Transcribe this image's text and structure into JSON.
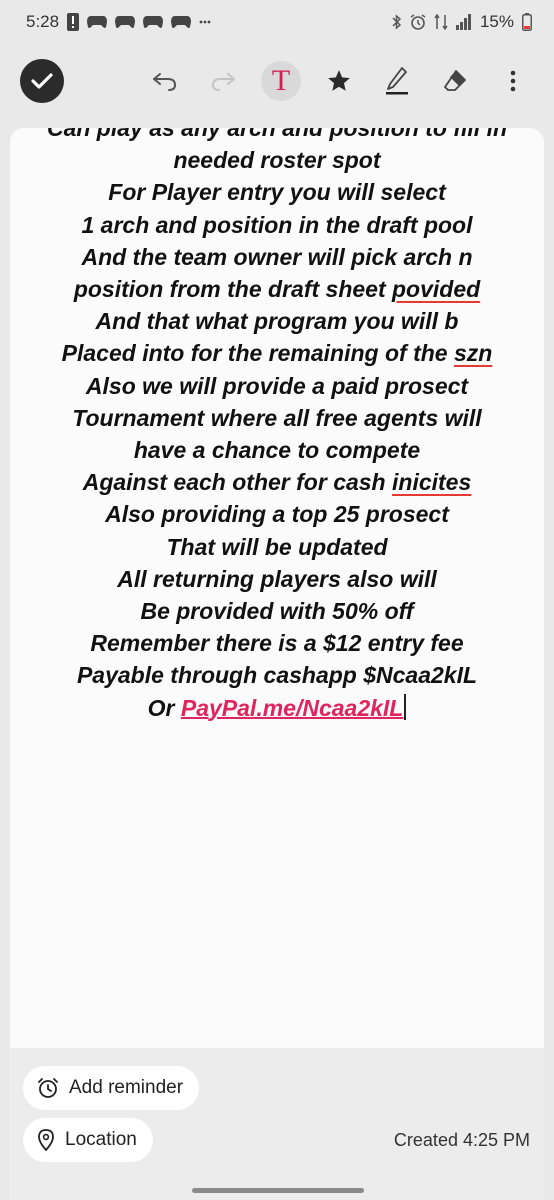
{
  "status_bar": {
    "time": "5:28",
    "battery": "15%",
    "icons": [
      "alert-icon",
      "game-controller-icon",
      "game-controller-icon",
      "game-controller-icon",
      "game-controller-icon",
      "more-dots-icon",
      "bluetooth-icon",
      "alarm-icon",
      "wifi-icon",
      "signal-icon",
      "battery-icon"
    ]
  },
  "toolbar": {
    "text_tool_label": "T",
    "icons": [
      "check-icon",
      "undo-icon",
      "redo-icon",
      "text-style-icon",
      "star-icon",
      "pen-icon",
      "eraser-icon",
      "more-vert-icon"
    ]
  },
  "note": {
    "lines": [
      [
        {
          "t": "Can play as any arch and position to fill in"
        }
      ],
      [
        {
          "t": "needed roster spot"
        }
      ],
      [
        {
          "t": "For Player entry you will select"
        }
      ],
      [
        {
          "t": "1 arch and position in the draft pool"
        }
      ],
      [
        {
          "t": "And the team owner will pick arch n"
        }
      ],
      [
        {
          "t": "position from the draft sheet "
        },
        {
          "t": "povided",
          "misspell": true
        }
      ],
      [
        {
          "t": "And that what program you will b"
        }
      ],
      [
        {
          "t": "Placed into for the remaining of the "
        },
        {
          "t": "szn",
          "misspell": true
        }
      ],
      [
        {
          "t": "Also we will provide a paid prosect"
        }
      ],
      [
        {
          "t": "Tournament where all free agents will"
        }
      ],
      [
        {
          "t": "have a chance to compete"
        }
      ],
      [
        {
          "t": "Against each other for cash "
        },
        {
          "t": "inicites",
          "misspell": true
        }
      ],
      [
        {
          "t": "Also providing a top 25 prosect"
        }
      ],
      [
        {
          "t": "That will be updated"
        }
      ],
      [
        {
          "t": "All returning players also will"
        }
      ],
      [
        {
          "t": "Be provided with 50% off"
        }
      ],
      [
        {
          "t": "Remember there is a $12 entry fee"
        }
      ],
      [
        {
          "t": "Payable through cashapp $Ncaa2kIL"
        }
      ],
      [
        {
          "t": "Or "
        },
        {
          "t": "PayPal.me/Ncaa2kIL",
          "link": true
        }
      ]
    ]
  },
  "bottom": {
    "add_reminder": "Add reminder",
    "location": "Location",
    "created": "Created 4:25 PM"
  },
  "colors": {
    "accent": "#e0245e",
    "misspell_underline": "#e53935",
    "card": "#fbfbfb",
    "background": "#e9e9e9"
  }
}
